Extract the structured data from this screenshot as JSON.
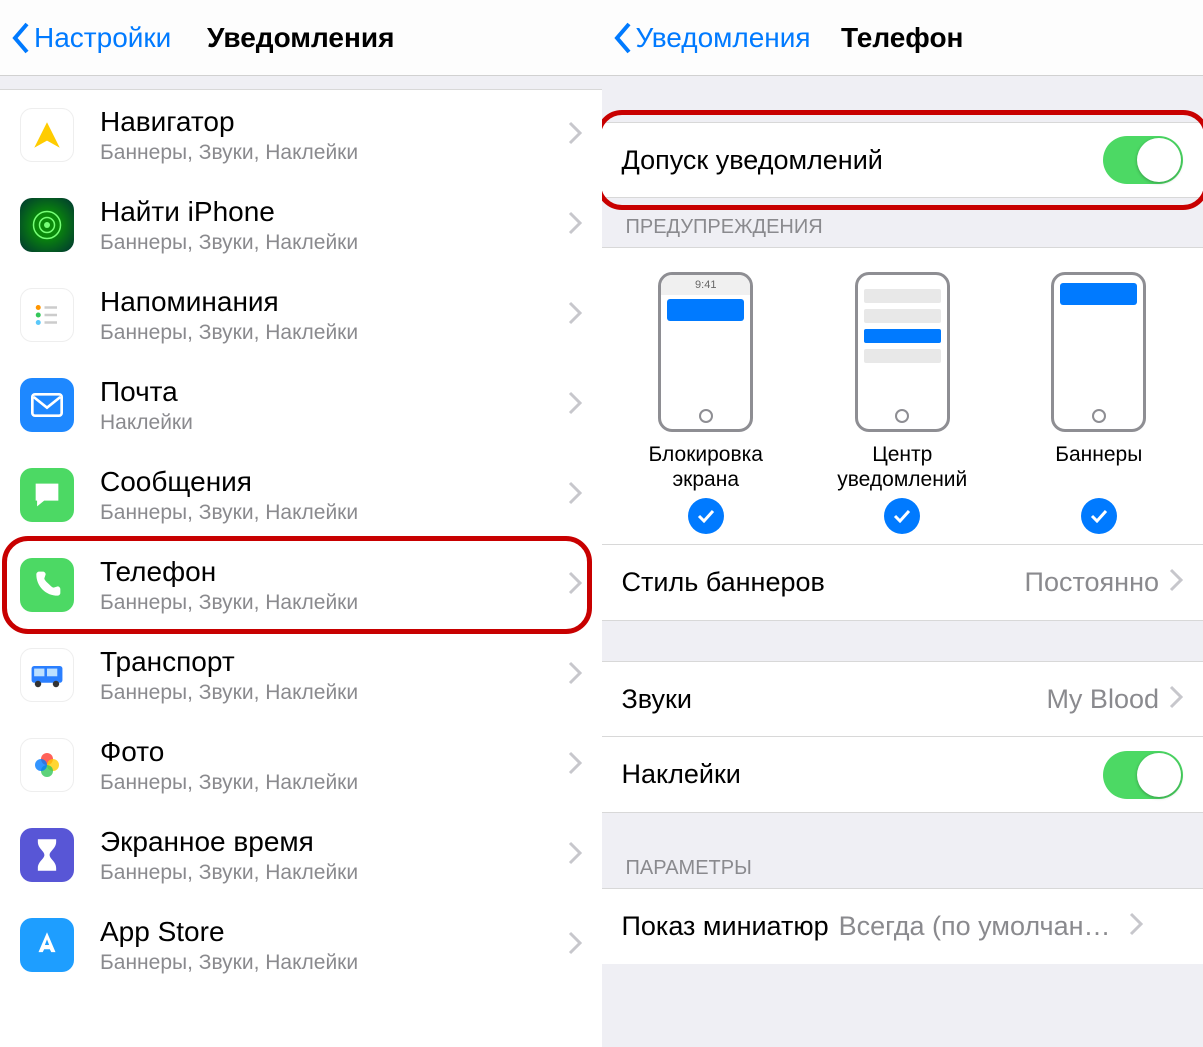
{
  "left": {
    "back": "Настройки",
    "title": "Уведомления",
    "apps": [
      {
        "id": "navigator",
        "name": "Навигатор",
        "sub": "Баннеры, Звуки, Наклейки"
      },
      {
        "id": "find",
        "name": "Найти iPhone",
        "sub": "Баннеры, Звуки, Наклейки"
      },
      {
        "id": "reminders",
        "name": "Напоминания",
        "sub": "Баннеры, Звуки, Наклейки"
      },
      {
        "id": "mail",
        "name": "Почта",
        "sub": "Наклейки"
      },
      {
        "id": "messages",
        "name": "Сообщения",
        "sub": "Баннеры, Звуки, Наклейки"
      },
      {
        "id": "phone",
        "name": "Телефон",
        "sub": "Баннеры, Звуки, Наклейки",
        "highlight": true
      },
      {
        "id": "transport",
        "name": "Транспорт",
        "sub": "Баннеры, Звуки, Наклейки"
      },
      {
        "id": "photos",
        "name": "Фото",
        "sub": "Баннеры, Звуки, Наклейки"
      },
      {
        "id": "screentime",
        "name": "Экранное время",
        "sub": "Баннеры, Звуки, Наклейки"
      },
      {
        "id": "appstore",
        "name": "App Store",
        "sub": "Баннеры, Звуки, Наклейки"
      }
    ]
  },
  "right": {
    "back": "Уведомления",
    "title": "Телефон",
    "allow": {
      "label": "Допуск уведомлений",
      "on": true,
      "highlight": true
    },
    "alerts_header": "ПРЕДУПРЕЖДЕНИЯ",
    "alert_types": [
      {
        "id": "lock",
        "label": "Блокировка экрана",
        "checked": true,
        "time": "9:41"
      },
      {
        "id": "center",
        "label": "Центр уведомлений",
        "checked": true
      },
      {
        "id": "banners",
        "label": "Баннеры",
        "checked": true
      }
    ],
    "banner_style": {
      "label": "Стиль баннеров",
      "value": "Постоянно"
    },
    "sounds": {
      "label": "Звуки",
      "value": "My Blood"
    },
    "badges": {
      "label": "Наклейки",
      "on": true
    },
    "options_header": "ПАРАМЕТРЫ",
    "previews": {
      "label": "Показ миниатюр",
      "value": "Всегда (по умолчани..."
    }
  }
}
